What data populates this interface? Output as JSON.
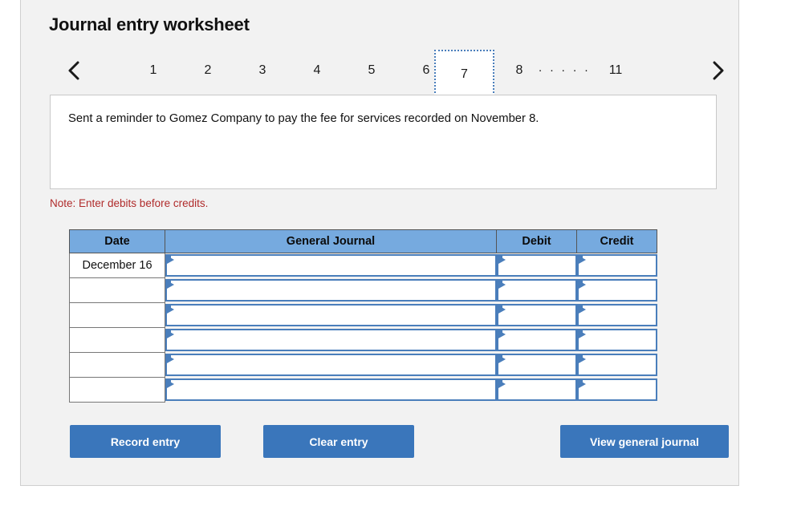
{
  "page_title": "Journal entry worksheet",
  "pager": {
    "prev_icon": "chevron-left-icon",
    "next_icon": "chevron-right-icon",
    "pages": [
      "1",
      "2",
      "3",
      "4",
      "5",
      "6",
      "7",
      "8"
    ],
    "ellipsis": ". . . . .",
    "last_page": "11",
    "active_page": "7"
  },
  "description": {
    "text": "Sent a reminder to Gomez Company to pay the fee for services recorded on November 8."
  },
  "note": "Note: Enter debits before credits.",
  "table": {
    "headers": {
      "date": "Date",
      "general_journal": "General Journal",
      "debit": "Debit",
      "credit": "Credit"
    },
    "rows": [
      {
        "date": "December 16",
        "general_journal": "",
        "debit": "",
        "credit": ""
      },
      {
        "date": "",
        "general_journal": "",
        "debit": "",
        "credit": ""
      },
      {
        "date": "",
        "general_journal": "",
        "debit": "",
        "credit": ""
      },
      {
        "date": "",
        "general_journal": "",
        "debit": "",
        "credit": ""
      },
      {
        "date": "",
        "general_journal": "",
        "debit": "",
        "credit": ""
      },
      {
        "date": "",
        "general_journal": "",
        "debit": "",
        "credit": ""
      }
    ]
  },
  "buttons": {
    "record": "Record entry",
    "clear": "Clear entry",
    "view": "View general journal"
  },
  "colors": {
    "header_blue": "#76aadf",
    "button_blue": "#3a76bb",
    "cell_border_blue": "#4a7ebb",
    "note_red": "#b02b2b",
    "card_bg": "#f2f2f2"
  }
}
